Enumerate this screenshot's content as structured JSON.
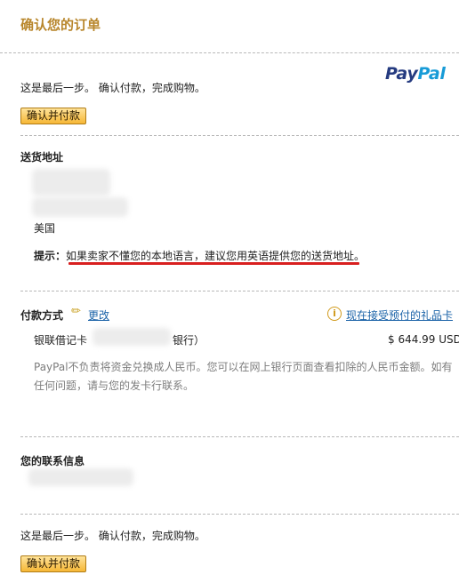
{
  "header": {
    "title": "确认您的订单"
  },
  "brand": {
    "logo_pay": "Pay",
    "logo_pal": "Pal",
    "color_primary": "#253b80",
    "color_secondary": "#179bd7"
  },
  "top": {
    "message": "这是最后一步。 确认付款，完成购物。",
    "confirm_button": "确认并付款"
  },
  "shipping": {
    "heading": "送货地址",
    "country": "美国",
    "hint_label": "提示：",
    "hint_text": "如果卖家不懂您的本地语言，建议您用英语提供您的送货地址。"
  },
  "payment": {
    "heading": "付款方式",
    "edit_link": "更改",
    "gift_card_link": "现在接受预付的礼品卡",
    "card_prefix": "银联借记卡",
    "card_suffix": "银行）",
    "amount": "$ 644.99 USD",
    "note": "PayPal不负责将资金兑换成人民币。您可以在网上银行页面查看扣除的人民币金额。如有任何问题，请与您的发卡行联系。"
  },
  "contact": {
    "heading": "您的联系信息"
  },
  "bottom": {
    "message": "这是最后一步。 确认付款，完成购物。",
    "confirm_button": "确认并付款"
  },
  "icons": {
    "edit": "pencil-icon",
    "info": "info-circle-icon"
  }
}
